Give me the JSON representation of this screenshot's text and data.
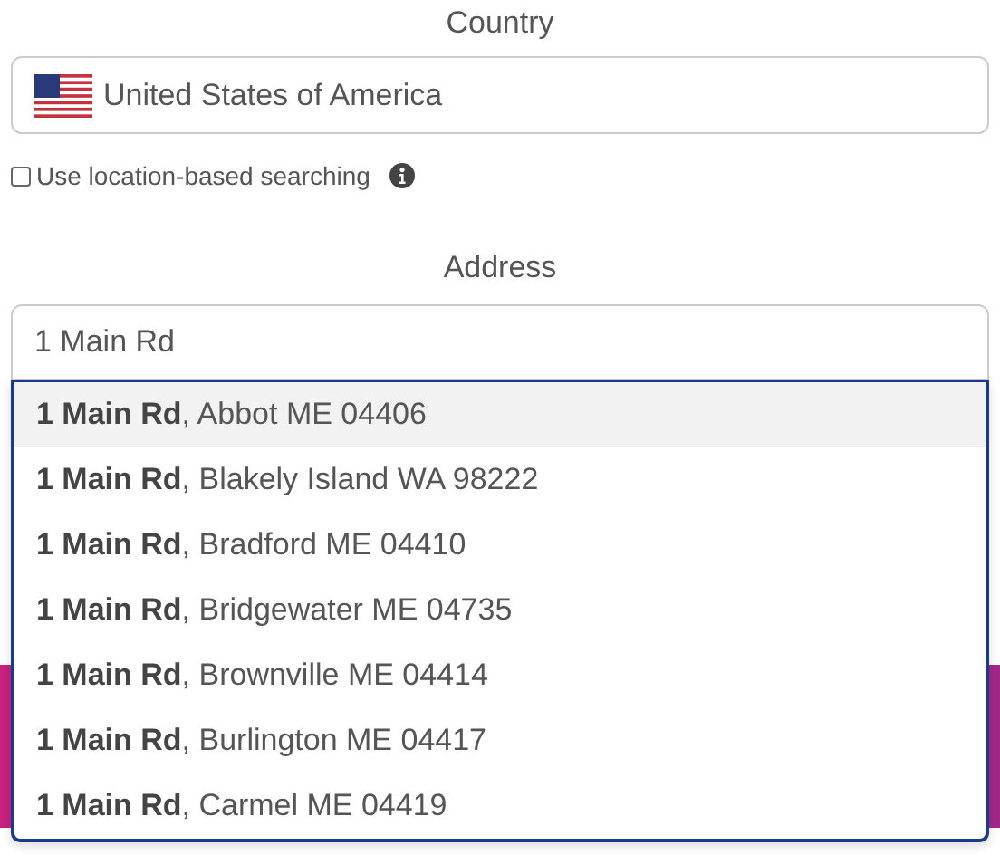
{
  "country": {
    "label": "Country",
    "value": "United States of America"
  },
  "location_search": {
    "label": "Use location-based searching",
    "checked": false
  },
  "address": {
    "label": "Address",
    "value": "1 Main Rd"
  },
  "suggestions": [
    {
      "text": "**1 Main Rd**, Abbot ME 04406",
      "selected": true
    },
    {
      "text": "**1 Main Rd**, Blakely Island WA 98222",
      "selected": false
    },
    {
      "text": "**1 Main Rd**, Bradford ME 04410",
      "selected": false
    },
    {
      "text": "**1 Main Rd**, Bridgewater ME 04735",
      "selected": false
    },
    {
      "text": "**1 Main Rd**, Brownville ME 04414",
      "selected": false
    },
    {
      "text": "**1 Main Rd**, Burlington ME 04417",
      "selected": false
    },
    {
      "text": "**1 Main Rd**, Carmel ME 04419",
      "selected": false
    }
  ]
}
